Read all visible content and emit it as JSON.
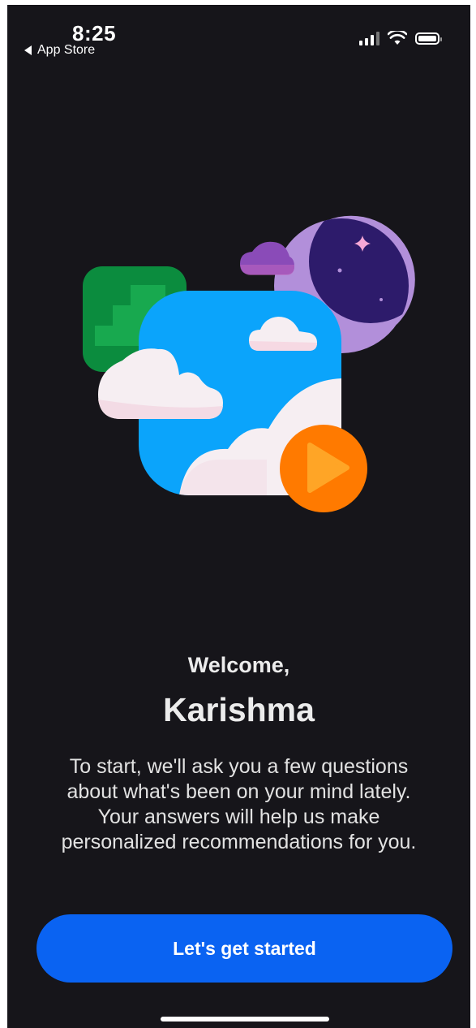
{
  "status_bar": {
    "time": "8:25",
    "back_label": "App Store",
    "icons": [
      "signal-icon",
      "wifi-icon",
      "battery-icon"
    ]
  },
  "illustration": {
    "elements": [
      "staircase-tile",
      "sky-tile",
      "moon-circle",
      "cloud",
      "play-button"
    ],
    "colors": {
      "background": "#16151a",
      "green": "#0b8c3e",
      "sky": "#0ba4fb",
      "moon_light": "#b28fda",
      "moon_dark": "#2d1b6b",
      "cloud": "#f6eef2",
      "orange": "#ff7a00",
      "purple_cloud": "#8a4bb8"
    }
  },
  "welcome": {
    "greeting": "Welcome,",
    "name": "Karishma",
    "intro_lines": [
      "To start, we'll ask you a few questions",
      "about what's been on your mind lately.",
      "Your answers will help us make",
      "personalized recommendations for you."
    ]
  },
  "cta": {
    "label": "Let's get started",
    "color": "#0a63f2"
  }
}
